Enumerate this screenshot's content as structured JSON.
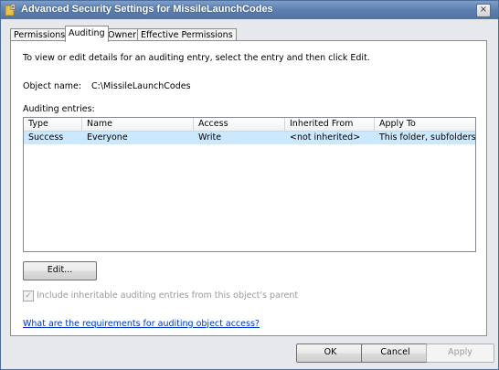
{
  "window": {
    "title": "Advanced Security Settings for MissileLaunchCodes",
    "close_label": "×"
  },
  "tabs": [
    {
      "label": "Permissions"
    },
    {
      "label": "Auditing"
    },
    {
      "label": "Owner"
    },
    {
      "label": "Effective Permissions"
    }
  ],
  "active_tab": "Auditing",
  "auditing": {
    "instructions": "To view or edit details for an auditing entry, select the entry and then click Edit.",
    "object_name_label": "Object name:",
    "object_name_value": "C:\\MissileLaunchCodes",
    "entries_label": "Auditing entries:",
    "columns": [
      "Type",
      "Name",
      "Access",
      "Inherited From",
      "Apply To"
    ],
    "rows": [
      {
        "type": "Success",
        "name": "Everyone",
        "access": "Write",
        "inherited_from": "<not inherited>",
        "apply_to": "This folder, subfolders ..."
      }
    ],
    "edit_button": "Edit...",
    "include_inheritable_label": "Include inheritable auditing entries from this object's parent",
    "include_inheritable_checked": true,
    "include_inheritable_enabled": false,
    "help_link": "What are the requirements for auditing object access?"
  },
  "footer": {
    "ok": "OK",
    "cancel": "Cancel",
    "apply": "Apply"
  },
  "colors": {
    "titlebar": "#5f82b4",
    "selected_row": "#cce8ff",
    "link": "#0033cc",
    "disabled_text": "#9a9a9a"
  },
  "icons": {
    "title": "folder-lock-icon",
    "close": "close-icon",
    "checkbox": "check-icon"
  }
}
